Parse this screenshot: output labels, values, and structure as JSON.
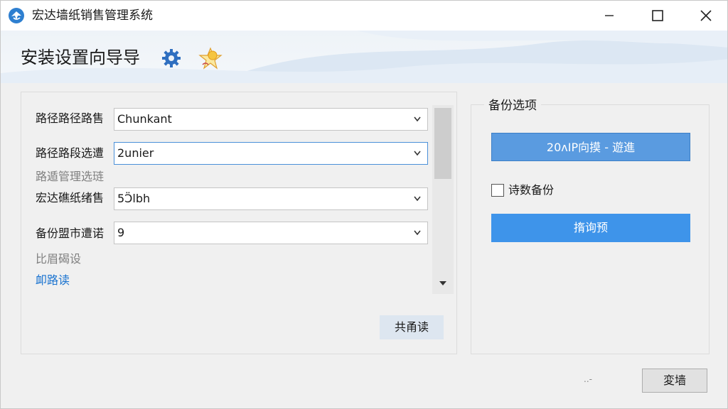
{
  "window": {
    "title": "宏达墙纸销售管理系统",
    "controls": {
      "minimize": "—",
      "maximize": "☐",
      "close": "✕"
    }
  },
  "banner": {
    "title": "安装设置向导导",
    "icons": [
      "gear-icon",
      "star-icon"
    ]
  },
  "left": {
    "rows": [
      {
        "label": "路径路径路售",
        "value": "Chunkant"
      },
      {
        "label": "路径路段选遭",
        "value": "2unier"
      },
      {
        "label": "宏达礁纸绪售",
        "value": "5Ɔ̈lbh"
      },
      {
        "label": "备份盟市遭诺",
        "value": "9"
      }
    ],
    "dim_label_1": "路遁管理选琏",
    "dim_label_2": "比眉碣设",
    "link_label": "卹路读",
    "button": "共甬读"
  },
  "right": {
    "group_title": "备份选项",
    "select_button": "20ᴧIP向摸 - 遊進",
    "checkbox_label": "诗数备份",
    "checkbox_checked": false,
    "preview_button": "㨊询预"
  },
  "footer": {
    "dots": "..-",
    "button": "変墙"
  },
  "colors": {
    "accent_blue": "#3e94ea",
    "select_blue": "#5a9be0",
    "link_blue": "#1a73d0"
  }
}
